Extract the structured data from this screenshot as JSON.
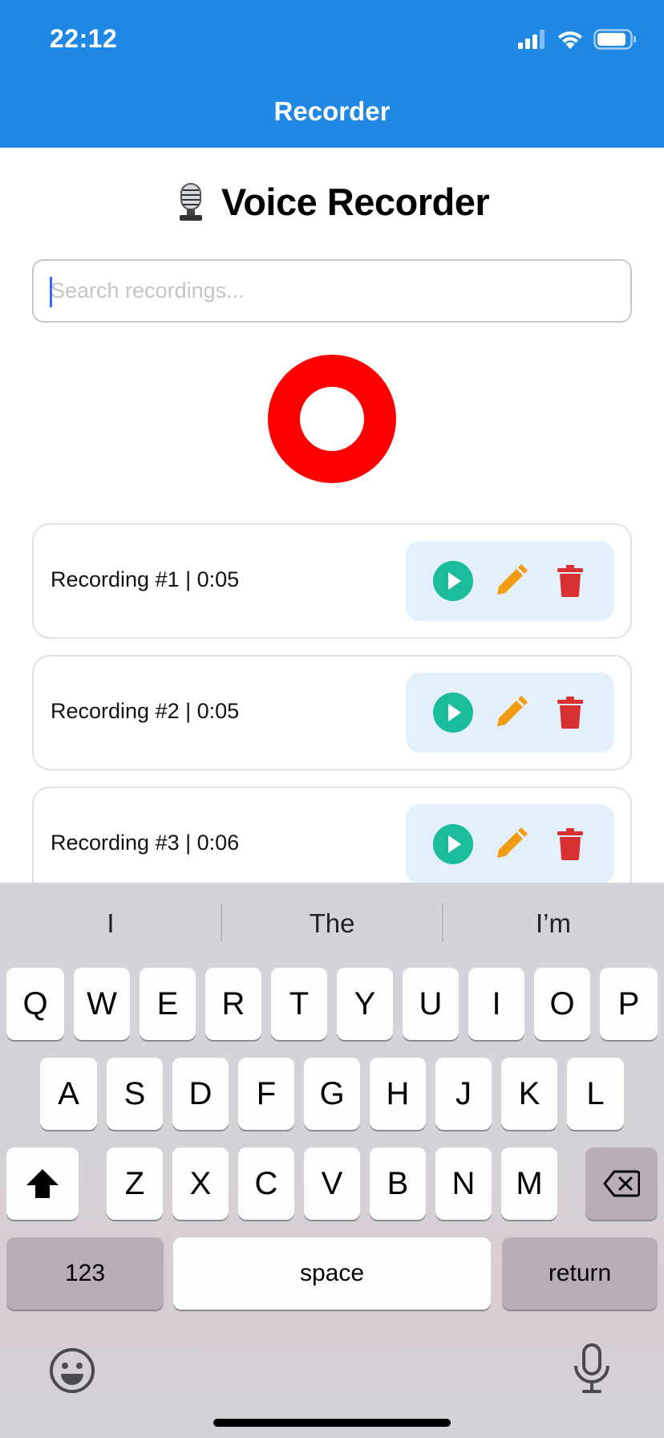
{
  "status_bar": {
    "time": "22:12"
  },
  "nav": {
    "title": "Recorder"
  },
  "page": {
    "title": "Voice Recorder"
  },
  "search": {
    "placeholder": "Search recordings..."
  },
  "recordings": [
    {
      "label": "Recording #1 | 0:05"
    },
    {
      "label": "Recording #2 | 0:05"
    },
    {
      "label": "Recording #3 | 0:06"
    }
  ],
  "colors": {
    "header": "#1f88e5",
    "record": "#ff0000",
    "play": "#1abc9c",
    "edit": "#f39c12",
    "delete": "#d63031",
    "actions_bg": "#e3f0fb"
  },
  "keyboard": {
    "suggestions": [
      "I",
      "The",
      "I’m"
    ],
    "row1": [
      "Q",
      "W",
      "E",
      "R",
      "T",
      "Y",
      "U",
      "I",
      "O",
      "P"
    ],
    "row2": [
      "A",
      "S",
      "D",
      "F",
      "G",
      "H",
      "J",
      "K",
      "L"
    ],
    "row3": [
      "Z",
      "X",
      "C",
      "V",
      "B",
      "N",
      "M"
    ],
    "numbers_label": "123",
    "space_label": "space",
    "return_label": "return"
  }
}
